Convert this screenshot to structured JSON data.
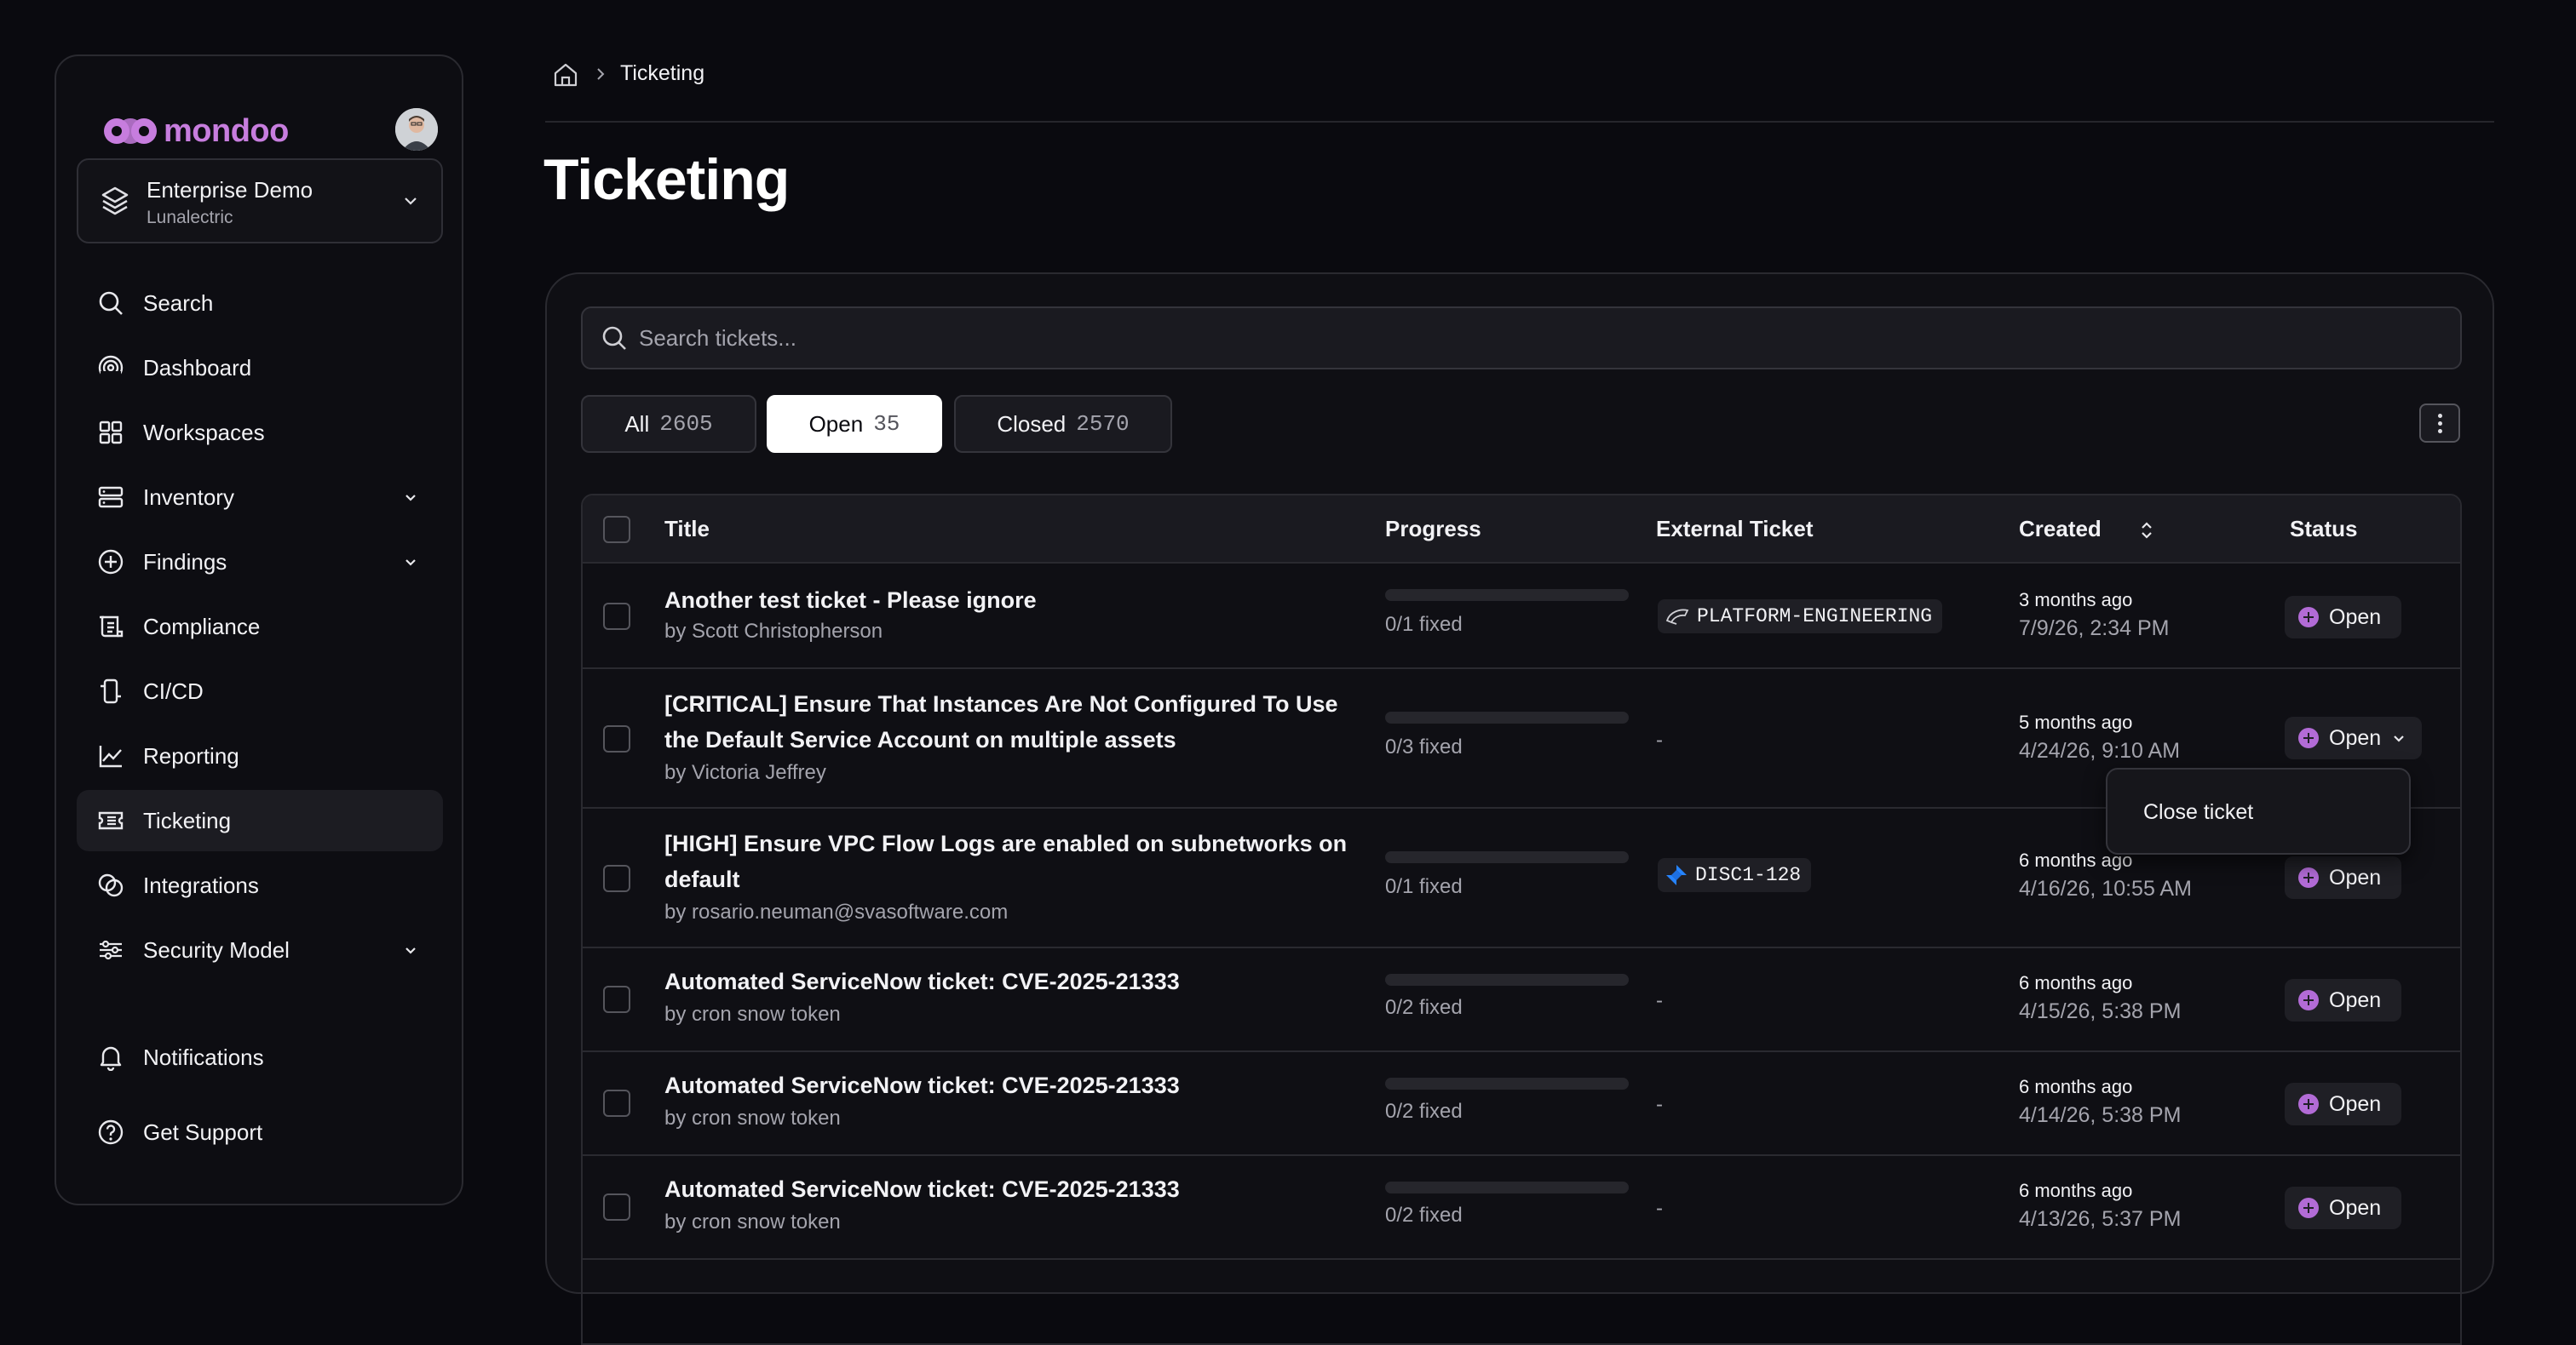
{
  "sidebar": {
    "logo_text": "mondoo",
    "org": {
      "name": "Enterprise Demo",
      "subtitle": "Lunalectric"
    },
    "nav": [
      {
        "label": "Search",
        "icon": "search-icon"
      },
      {
        "label": "Dashboard",
        "icon": "dashboard-icon"
      },
      {
        "label": "Workspaces",
        "icon": "workspaces-icon"
      },
      {
        "label": "Inventory",
        "icon": "inventory-icon",
        "expandable": true
      },
      {
        "label": "Findings",
        "icon": "findings-icon",
        "expandable": true
      },
      {
        "label": "Compliance",
        "icon": "compliance-icon"
      },
      {
        "label": "CI/CD",
        "icon": "cicd-icon"
      },
      {
        "label": "Reporting",
        "icon": "reporting-icon"
      },
      {
        "label": "Ticketing",
        "icon": "ticket-icon",
        "active": true
      },
      {
        "label": "Integrations",
        "icon": "integrations-icon"
      },
      {
        "label": "Security Model",
        "icon": "security-model-icon",
        "expandable": true
      },
      {
        "label": "Notifications",
        "icon": "bell-icon"
      },
      {
        "label": "Get Support",
        "icon": "help-icon"
      }
    ]
  },
  "breadcrumb": {
    "current": "Ticketing"
  },
  "page_title": "Ticketing",
  "search": {
    "placeholder": "Search tickets..."
  },
  "tabs": [
    {
      "label": "All",
      "count": "2605"
    },
    {
      "label": "Open",
      "count": "35",
      "active": true
    },
    {
      "label": "Closed",
      "count": "2570"
    }
  ],
  "table": {
    "headers": {
      "title": "Title",
      "progress": "Progress",
      "external": "External Ticket",
      "created": "Created",
      "status": "Status"
    },
    "rows": [
      {
        "title": "Another test ticket - Please ignore",
        "by": "by Scott Christopherson",
        "fixed": "0/1 fixed",
        "progress": 0,
        "external": "PLATFORM-ENGINEERING",
        "external_icon": "servicenow-icon",
        "created_rel": "3 months ago",
        "created_abs": "7/9/26, 2:34 PM",
        "status": "Open"
      },
      {
        "title": "[CRITICAL] Ensure That Instances Are Not Configured To Use the Default Service Account on multiple assets",
        "by": "by Victoria Jeffrey",
        "fixed": "0/3 fixed",
        "progress": 0,
        "external": "-",
        "created_rel": "5 months ago",
        "created_abs": "4/24/26, 9:10 AM",
        "status": "Open"
      },
      {
        "title": "[HIGH] Ensure VPC Flow Logs are enabled on subnetworks on default",
        "by": "by rosario.neuman@svasoftware.com",
        "fixed": "0/1 fixed",
        "progress": 0,
        "external": "DISC1-128",
        "external_icon": "jira-icon",
        "created_rel": "6 months ago",
        "created_abs": "4/16/26, 10:55 AM",
        "status": "Open"
      },
      {
        "title": "Automated ServiceNow ticket: CVE-2025-21333",
        "by": "by cron snow token",
        "fixed": "0/2 fixed",
        "progress": 0,
        "external": "-",
        "created_rel": "6 months ago",
        "created_abs": "4/15/26, 5:38 PM",
        "status": "Open"
      },
      {
        "title": "Automated ServiceNow ticket: CVE-2025-21333",
        "by": "by cron snow token",
        "fixed": "0/2 fixed",
        "progress": 0,
        "external": "-",
        "created_rel": "6 months ago",
        "created_abs": "4/14/26, 5:38 PM",
        "status": "Open"
      },
      {
        "title": "Automated ServiceNow ticket: CVE-2025-21333",
        "by": "by cron snow token",
        "fixed": "0/2 fixed",
        "progress": 0,
        "external": "-",
        "created_rel": "6 months ago",
        "created_abs": "4/13/26, 5:37 PM",
        "status": "Open"
      }
    ]
  },
  "status_menu": {
    "item": "Close ticket"
  },
  "colors": {
    "accent": "#c77dde",
    "status_dot": "#b26bd6",
    "background": "#0a0a0f"
  }
}
